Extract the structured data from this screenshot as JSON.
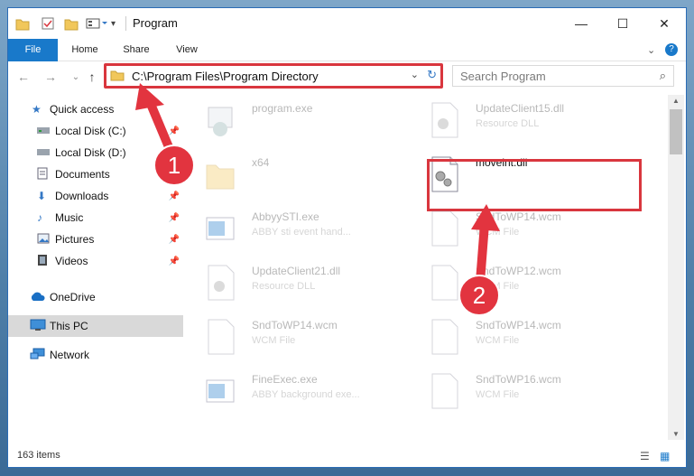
{
  "window": {
    "title": "Program"
  },
  "ribbon": {
    "tabs": [
      {
        "label": "File"
      },
      {
        "label": "Home"
      },
      {
        "label": "Share"
      },
      {
        "label": "View"
      }
    ]
  },
  "address": {
    "path": "C:\\Program Files\\Program Directory"
  },
  "search": {
    "placeholder": "Search Program"
  },
  "sidebar": {
    "items": [
      {
        "label": "Quick access"
      },
      {
        "label": "Local Disk (C:)"
      },
      {
        "label": "Local Disk (D:)"
      },
      {
        "label": "Documents"
      },
      {
        "label": "Downloads"
      },
      {
        "label": "Music"
      },
      {
        "label": "Pictures"
      },
      {
        "label": "Videos"
      },
      {
        "label": "OneDrive"
      },
      {
        "label": "This PC"
      },
      {
        "label": "Network"
      }
    ]
  },
  "files": [
    {
      "name": "program.exe",
      "desc": ""
    },
    {
      "name": "UpdateClient15.dll",
      "desc": "Resource DLL"
    },
    {
      "name": "x64",
      "desc": ""
    },
    {
      "name": "moveint.dll",
      "desc": ""
    },
    {
      "name": "AbbyySTI.exe",
      "desc": "ABBY sti event hand..."
    },
    {
      "name": "SndToWP14.wcm",
      "desc": "WCM File"
    },
    {
      "name": "UpdateClient21.dll",
      "desc": "Resource DLL"
    },
    {
      "name": "SndToWP12.wcm",
      "desc": "WCM File"
    },
    {
      "name": "SndToWP14.wcm",
      "desc": "WCM File"
    },
    {
      "name": "SndToWP14.wcm",
      "desc": "WCM File"
    },
    {
      "name": "FineExec.exe",
      "desc": "ABBY background exe..."
    },
    {
      "name": "SndToWP16.wcm",
      "desc": "WCM File"
    }
  ],
  "status": {
    "item_count": "163 items"
  },
  "annotations": {
    "step1": "1",
    "step2": "2"
  }
}
